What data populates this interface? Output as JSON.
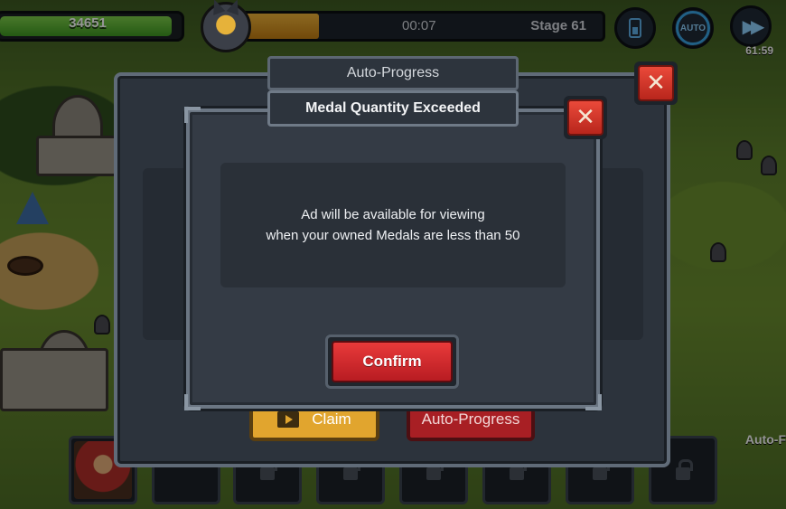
{
  "hud": {
    "hp_value": "34651",
    "timer": "00:07",
    "stage": "Stage 61",
    "stage_progress_percent": 22,
    "auto_label": "AUTO",
    "speed_timer": "61:59"
  },
  "back_dialog": {
    "title": "Auto-Progress",
    "close_symbol": "✕",
    "claim_label": "Claim",
    "auto_progress_label": "Auto-Progress"
  },
  "front_dialog": {
    "title": "Medal Quantity Exceeded",
    "close_symbol": "✕",
    "message_line1": "Ad will be available for viewing",
    "message_line2": "when your owned Medals are less than 50",
    "confirm_label": "Confirm"
  },
  "side_label": "Auto-F",
  "icons": {
    "battery": "battery-icon",
    "auto": "auto-icon",
    "fast_forward": "fast-forward-icon",
    "close": "close-icon",
    "film": "film-icon",
    "lock": "lock-icon"
  },
  "colors": {
    "hp_green": "#3f9a22",
    "progress_orange": "#f1b53a",
    "close_red": "#ea4a3a",
    "confirm_red": "#e83a3a",
    "claim_gold": "#e1a52e",
    "auto_blue": "#3aa5e6"
  }
}
